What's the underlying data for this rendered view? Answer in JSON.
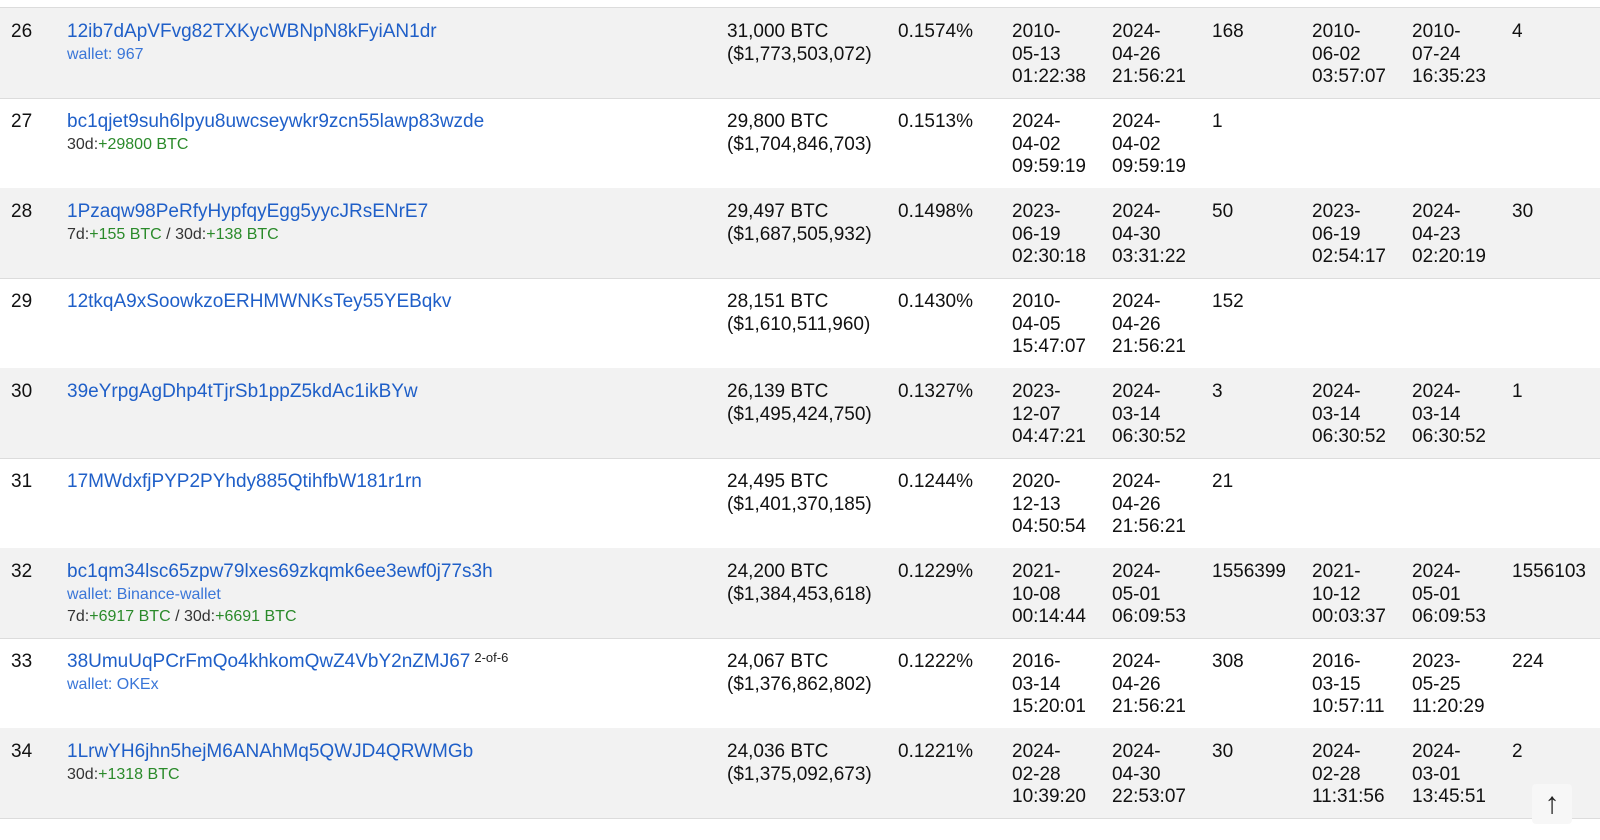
{
  "rows": [
    {
      "rank": "26",
      "address": "12ib7dApVFvg82TXKycWBNpN8kFyiAN1dr",
      "sig": "",
      "wallet": "wallet: 967",
      "change": [],
      "balance": "31,000 BTC",
      "usd": "($1,773,503,072)",
      "pct": "0.1574%",
      "first_in": [
        "2010-",
        "05-13",
        "01:22:38"
      ],
      "last_in": [
        "2024-",
        "04-26",
        "21:56:21"
      ],
      "ins": "168",
      "first_out": [
        "2010-",
        "06-02",
        "03:57:07"
      ],
      "last_out": [
        "2010-",
        "07-24",
        "16:35:23"
      ],
      "outs": "4"
    },
    {
      "rank": "27",
      "address": "bc1qjet9suh6lpyu8uwcseywkr9zcn55lawp83wzde",
      "sig": "",
      "wallet": "",
      "change": [
        {
          "label": "30d:",
          "value": "+29800 BTC"
        }
      ],
      "balance": "29,800 BTC",
      "usd": "($1,704,846,703)",
      "pct": "0.1513%",
      "first_in": [
        "2024-",
        "04-02",
        "09:59:19"
      ],
      "last_in": [
        "2024-",
        "04-02",
        "09:59:19"
      ],
      "ins": "1",
      "first_out": [],
      "last_out": [],
      "outs": ""
    },
    {
      "rank": "28",
      "address": "1Pzaqw98PeRfyHypfqyEgg5yycJRsENrE7",
      "sig": "",
      "wallet": "",
      "change": [
        {
          "label": "7d:",
          "value": "+155 BTC"
        },
        {
          "label": "30d:",
          "value": "+138 BTC"
        }
      ],
      "balance": "29,497 BTC",
      "usd": "($1,687,505,932)",
      "pct": "0.1498%",
      "first_in": [
        "2023-",
        "06-19",
        "02:30:18"
      ],
      "last_in": [
        "2024-",
        "04-30",
        "03:31:22"
      ],
      "ins": "50",
      "first_out": [
        "2023-",
        "06-19",
        "02:54:17"
      ],
      "last_out": [
        "2024-",
        "04-23",
        "02:20:19"
      ],
      "outs": "30"
    },
    {
      "rank": "29",
      "address": "12tkqA9xSoowkzoERHMWNKsTey55YEBqkv",
      "sig": "",
      "wallet": "",
      "change": [],
      "balance": "28,151 BTC",
      "usd": "($1,610,511,960)",
      "pct": "0.1430%",
      "first_in": [
        "2010-",
        "04-05",
        "15:47:07"
      ],
      "last_in": [
        "2024-",
        "04-26",
        "21:56:21"
      ],
      "ins": "152",
      "first_out": [],
      "last_out": [],
      "outs": ""
    },
    {
      "rank": "30",
      "address": "39eYrpgAgDhp4tTjrSb1ppZ5kdAc1ikBYw",
      "sig": "",
      "wallet": "",
      "change": [],
      "balance": "26,139 BTC",
      "usd": "($1,495,424,750)",
      "pct": "0.1327%",
      "first_in": [
        "2023-",
        "12-07",
        "04:47:21"
      ],
      "last_in": [
        "2024-",
        "03-14",
        "06:30:52"
      ],
      "ins": "3",
      "first_out": [
        "2024-",
        "03-14",
        "06:30:52"
      ],
      "last_out": [
        "2024-",
        "03-14",
        "06:30:52"
      ],
      "outs": "1"
    },
    {
      "rank": "31",
      "address": "17MWdxfjPYP2PYhdy885QtihfbW181r1rn",
      "sig": "",
      "wallet": "",
      "change": [],
      "balance": "24,495 BTC",
      "usd": "($1,401,370,185)",
      "pct": "0.1244%",
      "first_in": [
        "2020-",
        "12-13",
        "04:50:54"
      ],
      "last_in": [
        "2024-",
        "04-26",
        "21:56:21"
      ],
      "ins": "21",
      "first_out": [],
      "last_out": [],
      "outs": ""
    },
    {
      "rank": "32",
      "address": "bc1qm34lsc65zpw79lxes69zkqmk6ee3ewf0j77s3h",
      "sig": "",
      "wallet": "wallet: Binance-wallet",
      "change": [
        {
          "label": "7d:",
          "value": "+6917 BTC"
        },
        {
          "label": "30d:",
          "value": "+6691 BTC"
        }
      ],
      "balance": "24,200 BTC",
      "usd": "($1,384,453,618)",
      "pct": "0.1229%",
      "first_in": [
        "2021-",
        "10-08",
        "00:14:44"
      ],
      "last_in": [
        "2024-",
        "05-01",
        "06:09:53"
      ],
      "ins": "1556399",
      "first_out": [
        "2021-",
        "10-12",
        "00:03:37"
      ],
      "last_out": [
        "2024-",
        "05-01",
        "06:09:53"
      ],
      "outs": "1556103"
    },
    {
      "rank": "33",
      "address": "38UmuUqPCrFmQo4khkomQwZ4VbY2nZMJ67",
      "sig": "2-of-6",
      "wallet": "wallet: OKEx",
      "change": [],
      "balance": "24,067 BTC",
      "usd": "($1,376,862,802)",
      "pct": "0.1222%",
      "first_in": [
        "2016-",
        "03-14",
        "15:20:01"
      ],
      "last_in": [
        "2024-",
        "04-26",
        "21:56:21"
      ],
      "ins": "308",
      "first_out": [
        "2016-",
        "03-15",
        "10:57:11"
      ],
      "last_out": [
        "2023-",
        "05-25",
        "11:20:29"
      ],
      "outs": "224"
    },
    {
      "rank": "34",
      "address": "1LrwYH6jhn5hejM6ANAhMq5QWJD4QRWMGb",
      "sig": "",
      "wallet": "",
      "change": [
        {
          "label": "30d:",
          "value": "+1318 BTC"
        }
      ],
      "balance": "24,036 BTC",
      "usd": "($1,375,092,673)",
      "pct": "0.1221%",
      "first_in": [
        "2024-",
        "02-28",
        "10:39:20"
      ],
      "last_in": [
        "2024-",
        "04-30",
        "22:53:07"
      ],
      "ins": "30",
      "first_out": [
        "2024-",
        "02-28",
        "11:31:56"
      ],
      "last_out": [
        "2024-",
        "03-01",
        "13:45:51"
      ],
      "outs": "2"
    }
  ],
  "scroll_top": {
    "glyph": "↑"
  },
  "colors": {
    "link": "#1f5fc8",
    "positive": "#2a8a2a",
    "alt_row": "#f2f2f2"
  }
}
